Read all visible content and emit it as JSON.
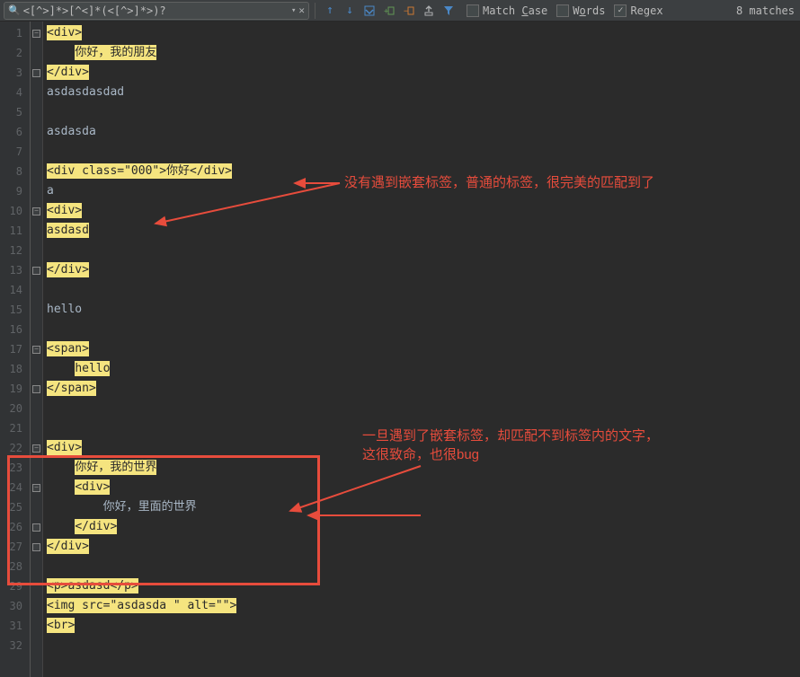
{
  "toolbar": {
    "search_value": "<[^>]*>[^<]*(<[^>]*>)?",
    "match_case": "Match Case",
    "words": "Words",
    "regex": "Regex",
    "match_count": "8 matches"
  },
  "annotations": {
    "note1": "没有遇到嵌套标签，普通的标签，很完美的匹配到了",
    "note2_line1": "一旦遇到了嵌套标签，却匹配不到标签内的文字，",
    "note2_line2": "这很致命，也很bug"
  },
  "lines": [
    {
      "num": "1",
      "fold": "minus",
      "indent": 0,
      "hl": true,
      "text": "<div>"
    },
    {
      "num": "2",
      "fold": "",
      "indent": 1,
      "hl": true,
      "text": "你好，我的朋友"
    },
    {
      "num": "3",
      "fold": "end",
      "indent": 0,
      "hl": true,
      "text": "</div>"
    },
    {
      "num": "4",
      "fold": "",
      "indent": 0,
      "hl": false,
      "text": "asdasdasdad"
    },
    {
      "num": "5",
      "fold": "",
      "indent": 0,
      "hl": false,
      "text": ""
    },
    {
      "num": "6",
      "fold": "",
      "indent": 0,
      "hl": false,
      "text": "asdasda"
    },
    {
      "num": "7",
      "fold": "",
      "indent": 0,
      "hl": false,
      "text": ""
    },
    {
      "num": "8",
      "fold": "",
      "indent": 0,
      "hl": true,
      "text": "<div class=\"000\">你好</div>"
    },
    {
      "num": "9",
      "fold": "",
      "indent": 0,
      "hl": false,
      "text": "a"
    },
    {
      "num": "10",
      "fold": "minus",
      "indent": 0,
      "hl": true,
      "text": "<div>"
    },
    {
      "num": "11",
      "fold": "",
      "indent": 0,
      "hl": true,
      "text": "asdasd"
    },
    {
      "num": "12",
      "fold": "",
      "indent": 0,
      "hl": false,
      "text": ""
    },
    {
      "num": "13",
      "fold": "end",
      "indent": 0,
      "hl": true,
      "text": "</div>"
    },
    {
      "num": "14",
      "fold": "",
      "indent": 0,
      "hl": false,
      "text": ""
    },
    {
      "num": "15",
      "fold": "",
      "indent": 0,
      "hl": false,
      "text": "hello"
    },
    {
      "num": "16",
      "fold": "",
      "indent": 0,
      "hl": false,
      "text": ""
    },
    {
      "num": "17",
      "fold": "minus",
      "indent": 0,
      "hl": true,
      "text": "<span>"
    },
    {
      "num": "18",
      "fold": "",
      "indent": 1,
      "hl": true,
      "text": "hello"
    },
    {
      "num": "19",
      "fold": "end",
      "indent": 0,
      "hl": true,
      "text": "</span>"
    },
    {
      "num": "20",
      "fold": "",
      "indent": 0,
      "hl": false,
      "text": ""
    },
    {
      "num": "21",
      "fold": "",
      "indent": 0,
      "hl": false,
      "text": ""
    },
    {
      "num": "22",
      "fold": "minus",
      "indent": 0,
      "hl": true,
      "text": "<div>"
    },
    {
      "num": "23",
      "fold": "",
      "indent": 1,
      "hl": true,
      "text": "你好，我的世界"
    },
    {
      "num": "24",
      "fold": "minus",
      "indent": 1,
      "hl": true,
      "text": "<div>"
    },
    {
      "num": "25",
      "fold": "",
      "indent": 2,
      "hl": false,
      "text": "你好，里面的世界"
    },
    {
      "num": "26",
      "fold": "end",
      "indent": 1,
      "hl": true,
      "text": "</div>"
    },
    {
      "num": "27",
      "fold": "end",
      "indent": 0,
      "hl": true,
      "text": "</div>"
    },
    {
      "num": "28",
      "fold": "",
      "indent": 0,
      "hl": false,
      "text": ""
    },
    {
      "num": "29",
      "fold": "",
      "indent": 0,
      "hl": true,
      "text": "<p>asdasd</p>"
    },
    {
      "num": "30",
      "fold": "",
      "indent": 0,
      "hl": true,
      "text": "<img src=\"asdasda \" alt=\"\">"
    },
    {
      "num": "31",
      "fold": "",
      "indent": 0,
      "hl": true,
      "text": "<br>"
    },
    {
      "num": "32",
      "fold": "",
      "indent": 0,
      "hl": false,
      "text": ""
    }
  ]
}
